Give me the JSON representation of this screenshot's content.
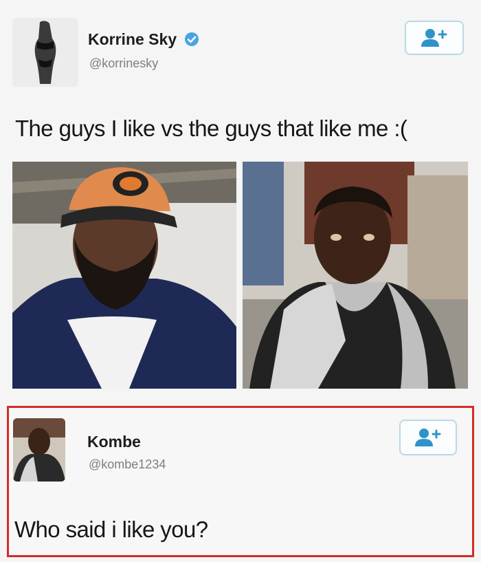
{
  "tweet": {
    "author_name": "Korrine Sky",
    "author_handle": "@korrinesky",
    "verified": true,
    "text": "The guys I like vs the guys that like me :(",
    "follow_icon": "add-user-icon",
    "photos": [
      {
        "icon": "photo-man-orange-cap"
      },
      {
        "icon": "photo-man-grey-jacket"
      }
    ]
  },
  "reply": {
    "author_name": "Kombe",
    "author_handle": "@kombe1234",
    "text": "Who said i like you?",
    "follow_icon": "add-user-icon",
    "highlight_color": "#d22a2a"
  },
  "colors": {
    "verified_badge": "#4aa3df",
    "follow_icon": "#2f93c9",
    "follow_border": "#b9d8e6"
  }
}
